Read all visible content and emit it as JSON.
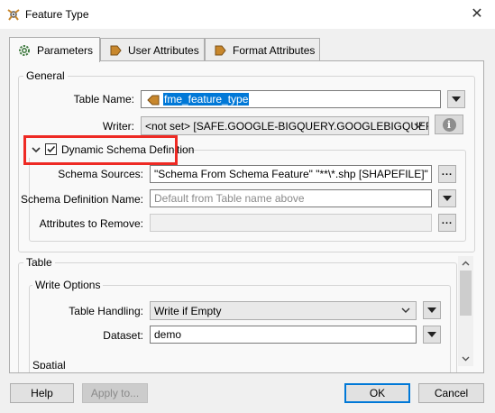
{
  "window": {
    "title": "Feature Type",
    "close_glyph": "✕"
  },
  "tabs": [
    {
      "label": "Parameters",
      "icon": "gear-icon"
    },
    {
      "label": "User Attributes",
      "icon": "arrow-right-icon"
    },
    {
      "label": "Format Attributes",
      "icon": "arrow-right-icon"
    }
  ],
  "general": {
    "title": "General",
    "table_name_label": "Table Name:",
    "table_name_value": "fme_feature_type",
    "writer_label": "Writer:",
    "writer_value": "<not set> [SAFE.GOOGLE-BIGQUERY.GOOGLEBIGQUERY]",
    "dynamic_schema": {
      "label": "Dynamic Schema Definition",
      "checked": true,
      "schema_sources_label": "Schema Sources:",
      "schema_sources_value": "\"Schema From Schema Feature\" \"**\\*.shp [SHAPEFILE]\"",
      "schema_def_name_label": "Schema Definition Name:",
      "schema_def_name_placeholder": "Default from Table name above",
      "attrs_remove_label": "Attributes to Remove:",
      "attrs_remove_value": ""
    }
  },
  "table": {
    "title": "Table",
    "write_options_title": "Write Options",
    "table_handling_label": "Table Handling:",
    "table_handling_value": "Write if Empty",
    "dataset_label": "Dataset:",
    "dataset_value": "demo",
    "next_section_partial": "Spatial"
  },
  "buttons": {
    "help": "Help",
    "apply": "Apply to...",
    "ok": "OK",
    "cancel": "Cancel",
    "ellipsis": "..."
  },
  "colors": {
    "highlight": "#ee2a24",
    "selection": "#0078d7",
    "accent_icon": "#c8872c"
  }
}
